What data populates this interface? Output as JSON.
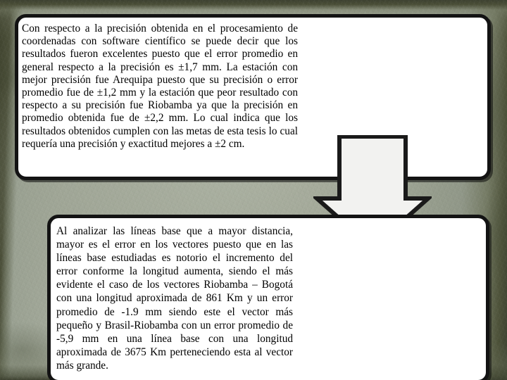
{
  "slide": {
    "background_color": "#a4ab9b",
    "frame_color": "#3d4130",
    "box_border_color": "#131313",
    "box_fill_color": "#ffffff",
    "text_color": "#000000"
  },
  "box_top": {
    "text": "Con respecto a la precisión obtenida en el procesamiento de coordenadas con software científico se puede decir que los resultados fueron excelentes puesto que el error promedio en general respecto a la precisión es ±1,7 mm. La estación con mejor precisión fue Arequipa puesto que su precisión o error promedio fue de ±1,2 mm y la estación que peor resultado con respecto a su precisión fue Riobamba ya que la precisión en promedio obtenida fue de ±2,2 mm. Lo cual indica que los resultados obtenidos cumplen con las metas de esta tesis lo cual requería una precisión y exactitud mejores a ±2 cm."
  },
  "box_bottom": {
    "text": "Al analizar las líneas base que a mayor distancia, mayor es el error en los vectores puesto que en las líneas base estudiadas es notorio el incremento del error conforme la longitud aumenta, siendo el más evidente el caso de los vectores Riobamba – Bogotá con una longitud aproximada de 861 Km y un error promedio de -1.9 mm siendo este el vector más pequeño y Brasil-Riobamba con un error promedio de -5,9 mm en una línea base con una longitud aproximada de 3675 Km perteneciendo esta al vector más grande."
  },
  "arrow": {
    "icon": "arrow-down-icon",
    "direction": "down",
    "fill_color": "#f2f2f0",
    "outline_color": "#1a1a1a"
  }
}
